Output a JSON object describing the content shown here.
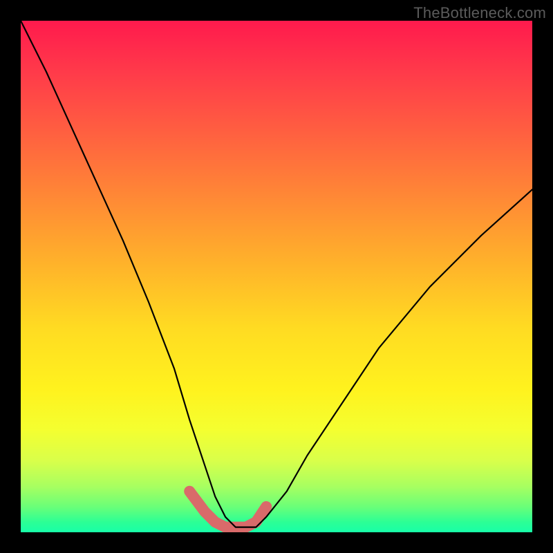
{
  "watermark": "TheBottleneck.com",
  "chart_data": {
    "type": "line",
    "title": "",
    "xlabel": "",
    "ylabel": "",
    "xlim": [
      0,
      100
    ],
    "ylim": [
      0,
      100
    ],
    "series": [
      {
        "name": "bottleneck-curve",
        "x": [
          0,
          5,
          10,
          15,
          20,
          25,
          30,
          33,
          36,
          38,
          40,
          42,
          44,
          46,
          48,
          52,
          56,
          62,
          70,
          80,
          90,
          100
        ],
        "values": [
          100,
          90,
          79,
          68,
          57,
          45,
          32,
          22,
          13,
          7,
          3,
          1,
          1,
          1,
          3,
          8,
          15,
          24,
          36,
          48,
          58,
          67
        ]
      },
      {
        "name": "highlight-segment",
        "x": [
          33,
          36,
          38,
          40,
          42,
          44,
          46,
          48
        ],
        "values": [
          8,
          4,
          2,
          1,
          1,
          1,
          2,
          5
        ]
      }
    ],
    "background_gradient": {
      "top": "#ff1a4d",
      "mid": "#ffe81f",
      "bottom": "#18ffa8"
    },
    "highlight_color": "#d96a6a",
    "curve_color": "#000000"
  }
}
